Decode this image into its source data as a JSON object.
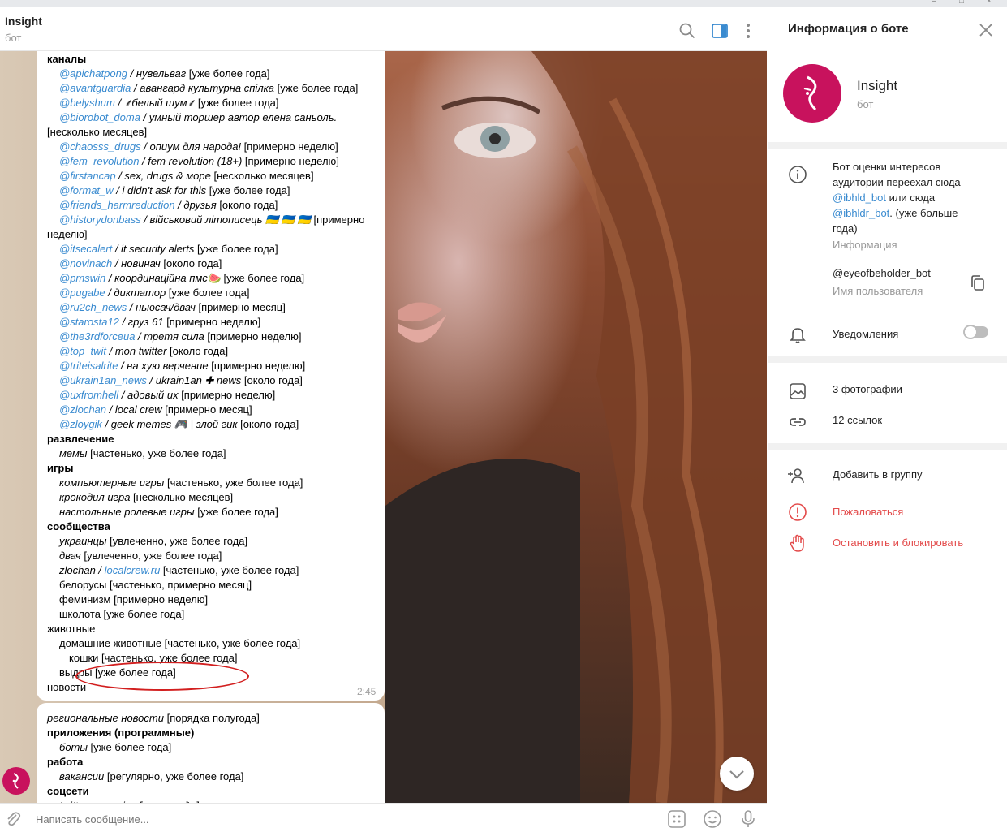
{
  "chat": {
    "title": "Insight",
    "subtitle": "бот",
    "input_placeholder": "Написать сообщение...",
    "message1": {
      "time": "2:45",
      "lines": [
        {
          "cls": "cat",
          "parts": [
            {
              "t": "каналы"
            }
          ]
        },
        {
          "cls": "ind",
          "parts": [
            {
              "t": "@apichatpong",
              "s": "lnk"
            },
            {
              "t": " / нувельваг",
              "s": "it"
            },
            {
              "t": " [уже более года]"
            }
          ]
        },
        {
          "cls": "ind",
          "parts": [
            {
              "t": "@avantguardia",
              "s": "lnk"
            },
            {
              "t": " / авангард культурна спілка",
              "s": "it"
            },
            {
              "t": " [уже более года]"
            }
          ]
        },
        {
          "cls": "ind",
          "parts": [
            {
              "t": "@belyshum",
              "s": "lnk"
            },
            {
              "t": " / ⸙белый шум⸙",
              "s": "it"
            },
            {
              "t": " [уже более года]"
            }
          ]
        },
        {
          "cls": "ind",
          "parts": [
            {
              "t": "@biorobot_doma",
              "s": "lnk"
            },
            {
              "t": " / умный торшер автор елена саньоль.",
              "s": "it"
            }
          ]
        },
        {
          "cls": "cont",
          "parts": [
            {
              "t": "[несколько месяцев]"
            }
          ]
        },
        {
          "cls": "ind",
          "parts": [
            {
              "t": "@chaosss_drugs",
              "s": "lnk"
            },
            {
              "t": " / опиум для народа!",
              "s": "it"
            },
            {
              "t": " [примерно неделю]"
            }
          ]
        },
        {
          "cls": "ind",
          "parts": [
            {
              "t": "@fem_revolution",
              "s": "lnk"
            },
            {
              "t": " / fem revolution (18+)",
              "s": "it"
            },
            {
              "t": " [примерно неделю]"
            }
          ]
        },
        {
          "cls": "ind",
          "parts": [
            {
              "t": "@firstancap",
              "s": "lnk"
            },
            {
              "t": " / sex, drugs & море",
              "s": "it"
            },
            {
              "t": " [несколько месяцев]"
            }
          ]
        },
        {
          "cls": "ind",
          "parts": [
            {
              "t": "@format_w",
              "s": "lnk"
            },
            {
              "t": " / i didn't ask for this",
              "s": "it"
            },
            {
              "t": " [уже более года]"
            }
          ]
        },
        {
          "cls": "ind",
          "parts": [
            {
              "t": "@friends_harmreduction",
              "s": "lnk"
            },
            {
              "t": " / друзья",
              "s": "it"
            },
            {
              "t": " [около года]"
            }
          ]
        },
        {
          "cls": "ind",
          "parts": [
            {
              "t": "@historydonbass",
              "s": "lnk"
            },
            {
              "t": " / військовий літописець 🇺🇦 🇺🇦 🇺🇦",
              "s": "it"
            },
            {
              "t": " [примерно"
            }
          ]
        },
        {
          "cls": "cont",
          "parts": [
            {
              "t": "неделю]"
            }
          ]
        },
        {
          "cls": "ind",
          "parts": [
            {
              "t": "@itsecalert",
              "s": "lnk"
            },
            {
              "t": " / it security alerts",
              "s": "it"
            },
            {
              "t": " [уже более года]"
            }
          ]
        },
        {
          "cls": "ind",
          "parts": [
            {
              "t": "@novinach",
              "s": "lnk"
            },
            {
              "t": " / новинач",
              "s": "it"
            },
            {
              "t": " [около года]"
            }
          ]
        },
        {
          "cls": "ind",
          "parts": [
            {
              "t": "@pmswin",
              "s": "lnk"
            },
            {
              "t": " / координаційна пмс🍉",
              "s": "it"
            },
            {
              "t": " [уже более года]"
            }
          ]
        },
        {
          "cls": "ind",
          "parts": [
            {
              "t": "@pugabe",
              "s": "lnk"
            },
            {
              "t": " / диктатор",
              "s": "it"
            },
            {
              "t": " [уже более года]"
            }
          ]
        },
        {
          "cls": "ind",
          "parts": [
            {
              "t": "@ru2ch_news",
              "s": "lnk"
            },
            {
              "t": " / ньюсач/двач",
              "s": "it"
            },
            {
              "t": " [примерно месяц]"
            }
          ]
        },
        {
          "cls": "ind",
          "parts": [
            {
              "t": "@starosta12",
              "s": "lnk"
            },
            {
              "t": " / груз 61",
              "s": "it"
            },
            {
              "t": " [примерно неделю]"
            }
          ]
        },
        {
          "cls": "ind",
          "parts": [
            {
              "t": "@the3rdforceua",
              "s": "lnk"
            },
            {
              "t": " / третя сила",
              "s": "it"
            },
            {
              "t": " [примерно неделю]"
            }
          ]
        },
        {
          "cls": "ind",
          "parts": [
            {
              "t": "@top_twit",
              "s": "lnk"
            },
            {
              "t": " / mon twitter",
              "s": "it"
            },
            {
              "t": " [около года]"
            }
          ]
        },
        {
          "cls": "ind",
          "parts": [
            {
              "t": "@triteisalrite",
              "s": "lnk"
            },
            {
              "t": " / на хую верчение",
              "s": "it"
            },
            {
              "t": " [примерно неделю]"
            }
          ]
        },
        {
          "cls": "ind",
          "parts": [
            {
              "t": "@ukrain1an_news",
              "s": "lnk"
            },
            {
              "t": " / ukrain1an ✚ news",
              "s": "it"
            },
            {
              "t": " [около года]"
            }
          ]
        },
        {
          "cls": "ind",
          "parts": [
            {
              "t": "@uxfromhell",
              "s": "lnk"
            },
            {
              "t": " / адовый ux",
              "s": "it"
            },
            {
              "t": " [примерно неделю]"
            }
          ]
        },
        {
          "cls": "ind",
          "parts": [
            {
              "t": "@zlochan",
              "s": "lnk"
            },
            {
              "t": " / local crew",
              "s": "it"
            },
            {
              "t": " [примерно месяц]"
            }
          ]
        },
        {
          "cls": "ind",
          "parts": [
            {
              "t": "@zloygik",
              "s": "lnk"
            },
            {
              "t": " / geek memes 🎮 | злой гик",
              "s": "it"
            },
            {
              "t": " [около года]"
            }
          ]
        },
        {
          "cls": "cat",
          "parts": [
            {
              "t": "развлечение"
            }
          ]
        },
        {
          "cls": "ind",
          "parts": [
            {
              "t": "мемы",
              "s": "it"
            },
            {
              "t": " [частенько, уже более года]"
            }
          ]
        },
        {
          "cls": "cat",
          "parts": [
            {
              "t": "игры"
            }
          ]
        },
        {
          "cls": "ind",
          "parts": [
            {
              "t": "компьютерные игры",
              "s": "it"
            },
            {
              "t": " [частенько, уже более года]"
            }
          ]
        },
        {
          "cls": "ind",
          "parts": [
            {
              "t": "крокодил игра",
              "s": "it"
            },
            {
              "t": " [несколько месяцев]"
            }
          ]
        },
        {
          "cls": "ind",
          "parts": [
            {
              "t": "настольные ролевые игры",
              "s": "it"
            },
            {
              "t": " [уже более года]"
            }
          ]
        },
        {
          "cls": "cat",
          "parts": [
            {
              "t": "сообщества"
            }
          ]
        },
        {
          "cls": "ind",
          "parts": [
            {
              "t": "украинцы",
              "s": "it"
            },
            {
              "t": " [увлеченно, уже более года]"
            }
          ]
        },
        {
          "cls": "ind",
          "parts": [
            {
              "t": "двач",
              "s": "it"
            },
            {
              "t": " [увлеченно, уже более года]"
            }
          ]
        },
        {
          "cls": "ind",
          "parts": [
            {
              "t": "zlochan / ",
              "s": "it"
            },
            {
              "t": "localcrew.ru",
              "s": "lnk"
            },
            {
              "t": " [частенько, уже более года]"
            }
          ]
        },
        {
          "cls": "ind",
          "parts": [
            {
              "t": "белорусы [частенько, примерно месяц]"
            }
          ]
        },
        {
          "cls": "ind",
          "parts": [
            {
              "t": "феминизм [примерно неделю]"
            }
          ]
        },
        {
          "cls": "ind",
          "parts": [
            {
              "t": "школота [уже более года]"
            }
          ]
        },
        {
          "cls": "cont",
          "parts": [
            {
              "t": "животные"
            }
          ]
        },
        {
          "cls": "ind",
          "parts": [
            {
              "t": "домашние животные [частенько, уже более года]"
            }
          ]
        },
        {
          "cls": "ind2",
          "parts": [
            {
              "t": "кошки [частенько, уже более года]"
            }
          ]
        },
        {
          "cls": "ind",
          "parts": [
            {
              "t": "выдры [уже более года]"
            }
          ]
        },
        {
          "cls": "cont",
          "parts": [
            {
              "t": "новости"
            }
          ]
        }
      ]
    },
    "message2": {
      "lines": [
        {
          "cls": "cont",
          "parts": [
            {
              "t": "региональные новости",
              "s": "it"
            },
            {
              "t": " [порядка полугода]"
            }
          ]
        },
        {
          "cls": "cat",
          "parts": [
            {
              "t": "приложения (программные)"
            }
          ]
        },
        {
          "cls": "ind",
          "parts": [
            {
              "t": "боты",
              "s": "it"
            },
            {
              "t": " [уже более года]"
            }
          ]
        },
        {
          "cls": "cat",
          "parts": [
            {
              "t": "работа"
            }
          ]
        },
        {
          "cls": "ind",
          "parts": [
            {
              "t": "вакансии",
              "s": "it"
            },
            {
              "t": " [регулярно, уже более года]"
            }
          ]
        },
        {
          "cls": "cat",
          "parts": [
            {
              "t": "соцсети"
            }
          ]
        },
        {
          "cls": "ind",
          "parts": [
            {
              "t": "twitter mommies [около года]",
              "s": "it"
            }
          ]
        }
      ]
    }
  },
  "panel": {
    "title": "Информация о боте",
    "bot_name": "Insight",
    "bot_kind": "бот",
    "description_lines": [
      "Бот оценки интересов",
      "аудитории переехал сюда",
      "@ibhld_bot",
      " или сюда",
      "@ibhldr_bot",
      ". (уже больше",
      "года)"
    ],
    "description_label": "Информация",
    "username": "@eyeofbeholder_bot",
    "username_label": "Имя пользователя",
    "notifications": "Уведомления",
    "notifications_on": false,
    "photos": "3 фотографии",
    "links": "12 ссылок",
    "add_to_group": "Добавить в группу",
    "report": "Пожаловаться",
    "block": "Остановить и блокировать"
  },
  "colors": {
    "accent": "#3a8bd0",
    "danger": "#e34a4a",
    "bot_avatar": "#c8125d",
    "annotation": "#d21f1f"
  }
}
